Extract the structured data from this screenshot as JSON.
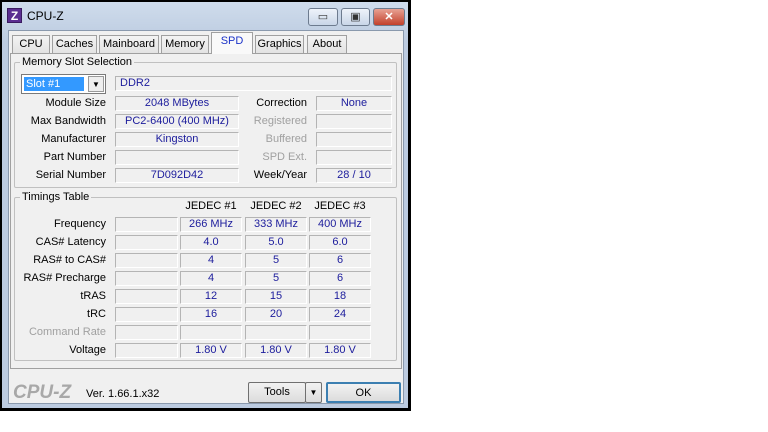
{
  "window": {
    "title": "CPU-Z",
    "app_icon_letter": "Z",
    "controls": {
      "minimize": "▭",
      "maximize": "▣",
      "close": "✕"
    }
  },
  "tabs": [
    {
      "label": "CPU"
    },
    {
      "label": "Caches"
    },
    {
      "label": "Mainboard"
    },
    {
      "label": "Memory"
    },
    {
      "label": "SPD",
      "active": true
    },
    {
      "label": "Graphics"
    },
    {
      "label": "About"
    }
  ],
  "slot": {
    "legend": "Memory Slot Selection",
    "selected": "Slot #1",
    "type": "DDR2",
    "fields": [
      {
        "label": "Module Size",
        "value": "2048 MBytes"
      },
      {
        "label": "Max Bandwidth",
        "value": "PC2-6400 (400 MHz)"
      },
      {
        "label": "Manufacturer",
        "value": "Kingston"
      },
      {
        "label": "Part Number",
        "value": ""
      },
      {
        "label": "Serial Number",
        "value": "7D092D42"
      }
    ],
    "right_fields": [
      {
        "label": "Correction",
        "value": "None",
        "disabled": false
      },
      {
        "label": "Registered",
        "value": "",
        "disabled": true
      },
      {
        "label": "Buffered",
        "value": "",
        "disabled": true
      },
      {
        "label": "SPD Ext.",
        "value": "",
        "disabled": true
      },
      {
        "label": "Week/Year",
        "value": "28 / 10",
        "disabled": false
      }
    ]
  },
  "timings": {
    "legend": "Timings Table",
    "headers": [
      "JEDEC #1",
      "JEDEC #2",
      "JEDEC #3"
    ],
    "rows": [
      {
        "label": "Frequency",
        "values": [
          "266 MHz",
          "333 MHz",
          "400 MHz"
        ]
      },
      {
        "label": "CAS# Latency",
        "values": [
          "4.0",
          "5.0",
          "6.0"
        ]
      },
      {
        "label": "RAS# to CAS#",
        "values": [
          "4",
          "5",
          "6"
        ]
      },
      {
        "label": "RAS# Precharge",
        "values": [
          "4",
          "5",
          "6"
        ]
      },
      {
        "label": "tRAS",
        "values": [
          "12",
          "15",
          "18"
        ]
      },
      {
        "label": "tRC",
        "values": [
          "16",
          "20",
          "24"
        ]
      },
      {
        "label": "Command Rate",
        "values": [
          "",
          "",
          ""
        ],
        "disabled": true
      },
      {
        "label": "Voltage",
        "values": [
          "1.80 V",
          "1.80 V",
          "1.80 V"
        ]
      }
    ]
  },
  "footer": {
    "logo": "CPU-Z",
    "version": "Ver. 1.66.1.x32",
    "tools": "Tools",
    "ok": "OK"
  }
}
